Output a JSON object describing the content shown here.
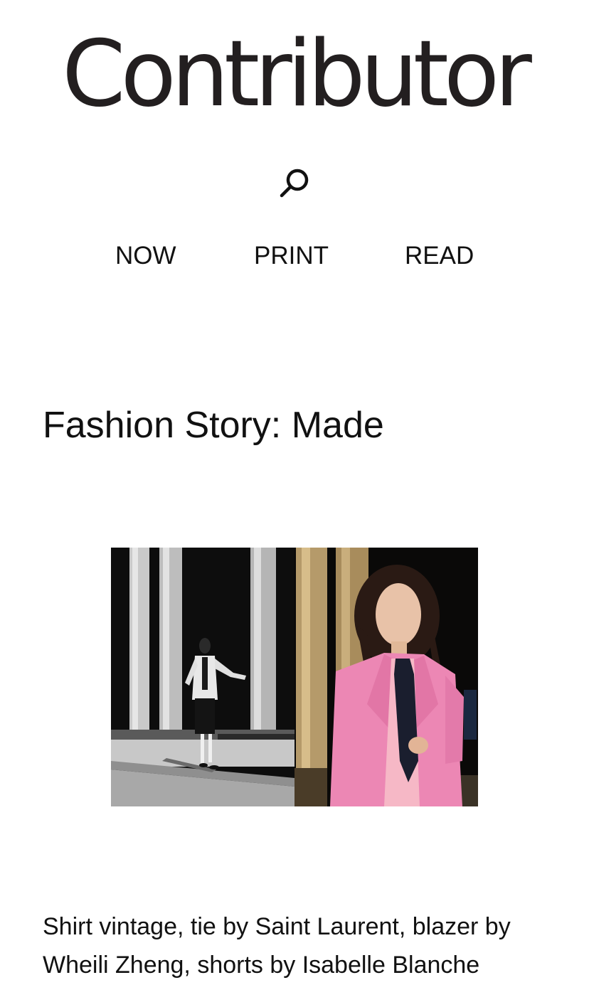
{
  "site": {
    "logo_text": "Contributor"
  },
  "header": {
    "search_icon": "search-icon"
  },
  "nav": {
    "items": [
      {
        "label": "NOW"
      },
      {
        "label": "PRINT"
      },
      {
        "label": "READ"
      }
    ]
  },
  "article": {
    "title": "Fashion Story: Made",
    "image": {
      "left_panel": "black-and-white photo of model in light blazer walking past columns",
      "right_panel": "color photo of model in pink blazer and dark tie"
    },
    "caption": "Shirt vintage, tie by Saint Laurent, blazer by Wheili Zheng, shorts by Isabelle Blanche"
  },
  "colors": {
    "text": "#111111",
    "logo": "#231f20",
    "background": "#ffffff",
    "blazer_pink": "#ec87b4"
  }
}
